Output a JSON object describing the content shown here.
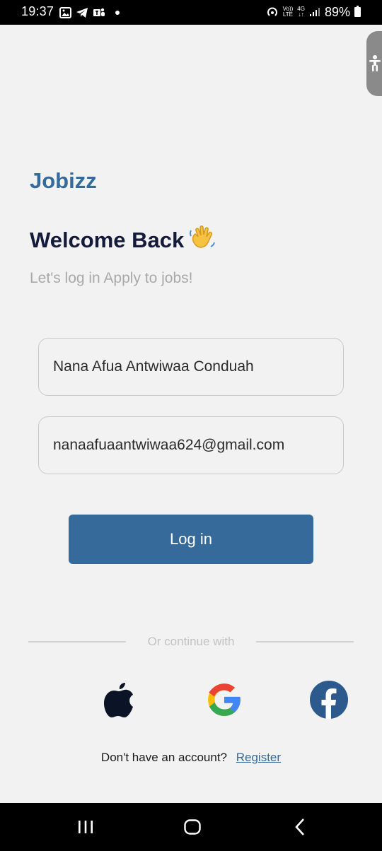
{
  "status_bar": {
    "time": "19:37",
    "network_top": "Vo))",
    "network_bottom": "LTE",
    "net_type_top": "4G",
    "net_type_bottom": "↓↑",
    "battery": "89%"
  },
  "app": {
    "brand": "Jobizz",
    "welcome": "Welcome Back",
    "welcome_emoji": "waving-hand-icon",
    "subtitle": "Let's log in Apply to jobs!"
  },
  "form": {
    "name_value": "Nana Afua Antwiwaa Conduah",
    "email_value": "nanaafuaantwiwaa624@gmail.com",
    "login_label": "Log in"
  },
  "social": {
    "divider_text": "Or continue with",
    "providers": [
      "apple-icon",
      "google-icon",
      "facebook-icon"
    ]
  },
  "footer": {
    "prompt": "Don't have an account?",
    "register_label": "Register"
  },
  "colors": {
    "brand": "#356a9a",
    "heading": "#141a3a",
    "subtitle": "#a9a9a9",
    "background": "#f2f2f2"
  }
}
